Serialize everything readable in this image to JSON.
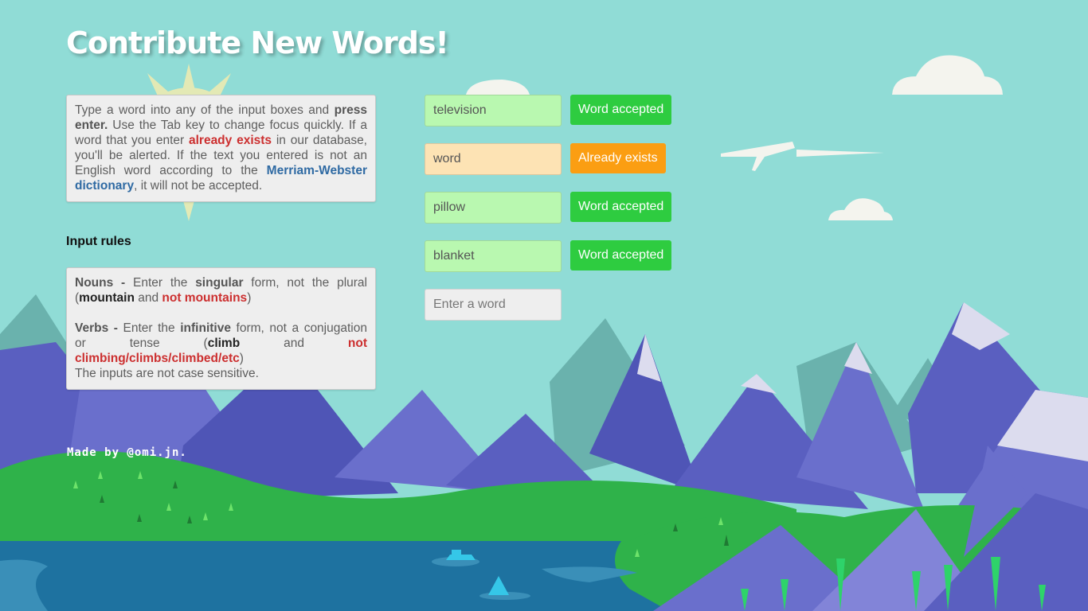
{
  "title": "Contribute New Words!",
  "intro": {
    "t1": "Type a word into any of the input boxes and ",
    "t2": "press enter.",
    "t3": " Use the Tab key to change focus quickly. If a word that you enter ",
    "t4": "already exists",
    "t5": " in our database, you'll be alerted. If the text you entered is not an English word according to the ",
    "t6": "Merriam-Webster dictionary",
    "t7": ", it will not be accepted."
  },
  "rules": {
    "heading": "Input rules",
    "nouns_label": "Nouns -",
    "nouns_t1": " Enter the ",
    "nouns_t2": "singular",
    "nouns_t3": " form, not the plural (",
    "nouns_good": "mountain",
    "nouns_t4": " and ",
    "nouns_bad": "not mountains",
    "nouns_t5": ")",
    "verbs_label": "Verbs -",
    "verbs_t1": " Enter the ",
    "verbs_t2": "infinitive",
    "verbs_t3": " form, not a conjugation or tense (",
    "verbs_good": "climb",
    "verbs_t4": " and ",
    "verbs_bad": "not climbing/climbs/climbed/etc",
    "verbs_t5": ")",
    "case_note": "The inputs are not case sensitive."
  },
  "credit": "Made by @omi.jn.",
  "entries": [
    {
      "value": "television",
      "status": "Word accepted",
      "input_bg": "#b9f8b0",
      "badge_bg": "#2ecc40"
    },
    {
      "value": "word",
      "status": "Already exists",
      "input_bg": "#fde3b4",
      "badge_bg": "#fb9e12"
    },
    {
      "value": "pillow",
      "status": "Word accepted",
      "input_bg": "#b9f8b0",
      "badge_bg": "#2ecc40"
    },
    {
      "value": "blanket",
      "status": "Word accepted",
      "input_bg": "#b9f8b0",
      "badge_bg": "#2ecc40"
    }
  ],
  "new_entry": {
    "placeholder": "Enter a word",
    "input_bg": "#eeeeee"
  },
  "colors": {
    "sky": "#90dcd6",
    "accepted": "#2ecc40",
    "exists": "#fb9e12",
    "alert_red": "#cc2f2f",
    "link_blue": "#2f6aa3"
  }
}
